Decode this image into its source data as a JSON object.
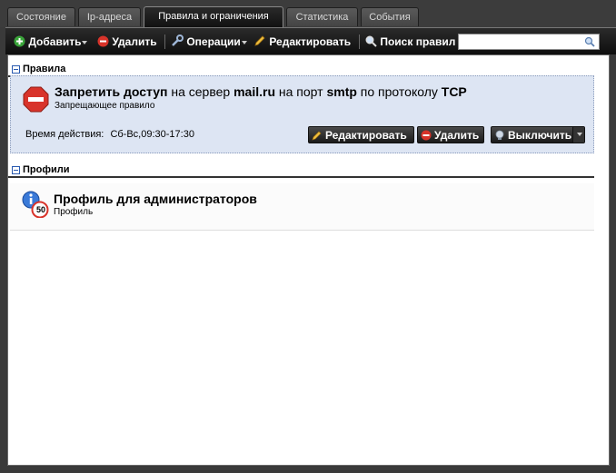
{
  "tabs": [
    {
      "label": "Состояние"
    },
    {
      "label": "Ip-адреса"
    },
    {
      "label": "Правила и ограничения"
    },
    {
      "label": "Статистика"
    },
    {
      "label": "События"
    }
  ],
  "active_tab": "Правила и ограничения",
  "toolbar": {
    "add_label": "Добавить",
    "delete_label": "Удалить",
    "operations_label": "Операции",
    "edit_label": "Редактировать",
    "search_label": "Поиск правил",
    "search_value": ""
  },
  "rules_section": {
    "title": "Правила",
    "rule": {
      "t1": "Запретить доступ",
      "t2": " на сервер ",
      "t3": "mail.ru",
      "t4": " на порт ",
      "t5": "smtp",
      "t6": " по протоколу ",
      "t7": "TCP",
      "subtitle": "Запрещающее правило",
      "time_label": "Время действия:",
      "time_value": "Сб-Вс,09:30-17:30",
      "edit_label": "Редактировать",
      "delete_label": "Удалить",
      "disable_label": "Выключить"
    }
  },
  "profiles_section": {
    "title": "Профили",
    "profile": {
      "title": "Профиль для администраторов",
      "subtitle": "Профиль",
      "badge": "50"
    }
  },
  "colors": {
    "accent": "#2a5ab0",
    "rule_bg": "#dde5f3",
    "deny_red": "#d8332a"
  }
}
